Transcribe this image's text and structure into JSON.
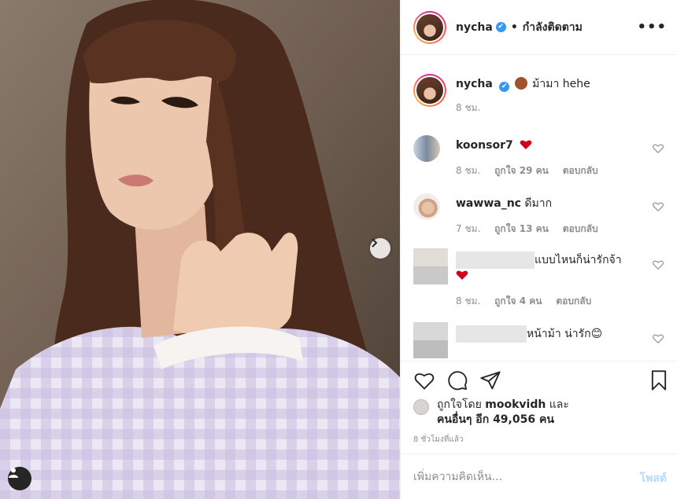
{
  "post": {
    "username": "nycha",
    "verified": "✔",
    "dot": "•",
    "following_label": "กำลังติดตาม",
    "more_label": "•••"
  },
  "caption": {
    "username": "nycha",
    "verified": "✔",
    "text": "ม้ามา hehe",
    "time": "8 ชม."
  },
  "comments": [
    {
      "username": "koonsor7",
      "text": "",
      "emoji": "heart",
      "time": "8 ชม.",
      "likes": "ถูกใจ 29 คน",
      "reply": "ตอบกลับ"
    },
    {
      "username": "wawwa_nc",
      "text": "ดีมาก",
      "time": "7 ชม.",
      "likes": "ถูกใจ 13 คน",
      "reply": "ตอบกลับ"
    },
    {
      "username": "",
      "text": "แบบไหนก็น่ารักจ้า",
      "emoji": "heart",
      "time": "8 ชม.",
      "likes": "ถูกใจ 4 คน",
      "reply": "ตอบกลับ"
    },
    {
      "username": "",
      "text": "หน้าม้า น่ารัก😊",
      "time": "",
      "likes": "",
      "reply": ""
    }
  ],
  "liked_by": {
    "prefix": "ถูกใจโดย",
    "user": "mookvidh",
    "and": "และ",
    "others": "คนอื่นๆ อีก 49,056 คน"
  },
  "timestamp": "8 ชั่วโมงที่แล้ว",
  "comment_input": {
    "placeholder": "เพิ่มความคิดเห็น...",
    "post_label": "โพสต์"
  },
  "colors": {
    "verified": "#3897f0",
    "heart": "#ed4956",
    "post_disabled": "#b3dbff",
    "meta": "#8e8e8e"
  }
}
